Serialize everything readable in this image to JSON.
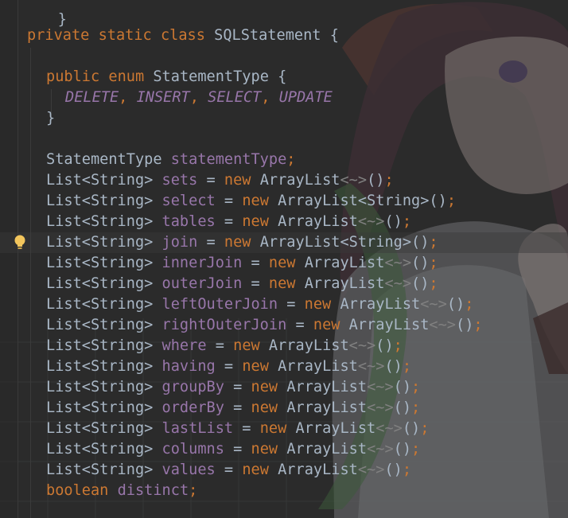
{
  "editor": {
    "top_partial": "}",
    "class_decl": {
      "kw1": "private",
      "kw2": "static",
      "kw3": "class",
      "name": "SQLStatement",
      "brace": "{"
    },
    "enum_decl": {
      "kw1": "public",
      "kw2": "enum",
      "name": "StatementType",
      "brace": "{"
    },
    "enum_values": {
      "v1": "DELETE",
      "v2": "INSERT",
      "v3": "SELECT",
      "v4": "UPDATE"
    },
    "enum_close": "}",
    "type_field": {
      "type": "StatementType",
      "name": "statementType"
    },
    "list_fields": [
      {
        "name": "sets",
        "ctor": "ArrayList",
        "gen": "<~>"
      },
      {
        "name": "select",
        "ctor": "ArrayList",
        "gen": "<String>"
      },
      {
        "name": "tables",
        "ctor": "ArrayList",
        "gen": "<~>"
      },
      {
        "name": "join",
        "ctor": "ArrayList",
        "gen": "<String>"
      },
      {
        "name": "innerJoin",
        "ctor": "ArrayList",
        "gen": "<~>"
      },
      {
        "name": "outerJoin",
        "ctor": "ArrayList",
        "gen": "<~>"
      },
      {
        "name": "leftOuterJoin",
        "ctor": "ArrayList",
        "gen": "<~>"
      },
      {
        "name": "rightOuterJoin",
        "ctor": "ArrayList",
        "gen": "<~>"
      },
      {
        "name": "where",
        "ctor": "ArrayList",
        "gen": "<~>"
      },
      {
        "name": "having",
        "ctor": "ArrayList",
        "gen": "<~>"
      },
      {
        "name": "groupBy",
        "ctor": "ArrayList",
        "gen": "<~>"
      },
      {
        "name": "orderBy",
        "ctor": "ArrayList",
        "gen": "<~>"
      },
      {
        "name": "lastList",
        "ctor": "ArrayList",
        "gen": "<~>"
      },
      {
        "name": "columns",
        "ctor": "ArrayList",
        "gen": "<~>"
      },
      {
        "name": "values",
        "ctor": "ArrayList",
        "gen": "<~>"
      }
    ],
    "list_type": "List<String>",
    "new_kw": "new",
    "bool_field": {
      "type": "boolean",
      "name": "distinct"
    },
    "intention_icon": "lightbulb-icon"
  },
  "colors": {
    "background": "#2b2b2b",
    "keyword": "#cc7832",
    "plain": "#a9b7c6",
    "field": "#9876aa",
    "generic": "#808080",
    "bulb": "#f2c55c"
  }
}
